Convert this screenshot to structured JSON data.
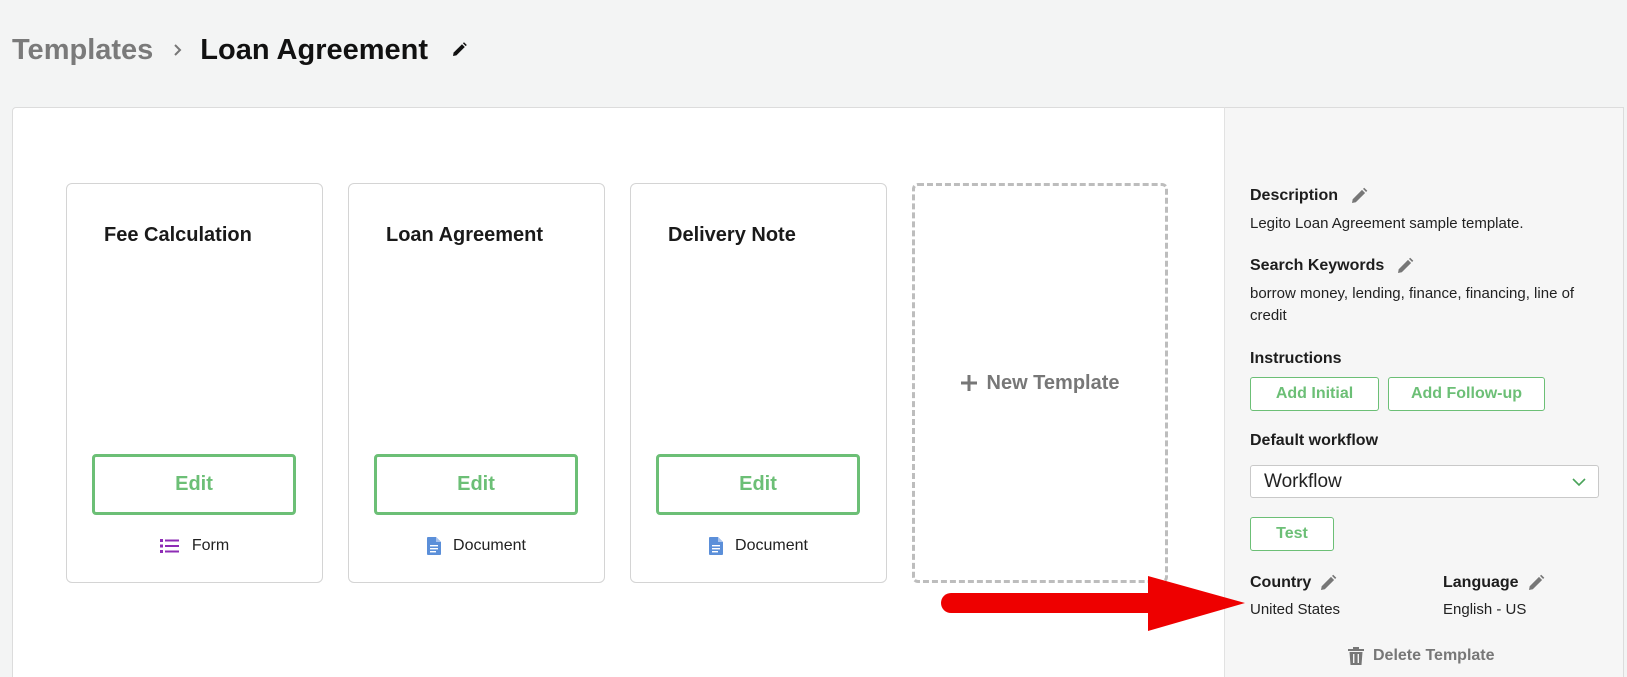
{
  "breadcrumb": {
    "root": "Templates",
    "current": "Loan Agreement"
  },
  "cards": [
    {
      "title": "Fee Calculation",
      "edit_label": "Edit",
      "type_label": "Form",
      "type_icon": "list-icon"
    },
    {
      "title": "Loan Agreement",
      "edit_label": "Edit",
      "type_label": "Document",
      "type_icon": "document-icon"
    },
    {
      "title": "Delivery Note",
      "edit_label": "Edit",
      "type_label": "Document",
      "type_icon": "document-icon"
    }
  ],
  "new_template": {
    "label": "New Template"
  },
  "side": {
    "description": {
      "label": "Description",
      "value": "Legito Loan Agreement sample template."
    },
    "keywords": {
      "label": "Search Keywords",
      "value": "borrow money, lending, finance, financing, line of credit"
    },
    "instructions": {
      "label": "Instructions",
      "add_initial": "Add Initial",
      "add_followup": "Add Follow-up"
    },
    "workflow": {
      "label": "Default workflow",
      "selected": "Workflow",
      "test_label": "Test"
    },
    "country": {
      "label": "Country",
      "value": "United States"
    },
    "language": {
      "label": "Language",
      "value": "English - US"
    },
    "delete_label": "Delete Template"
  },
  "colors": {
    "accent_green": "#6cbf76",
    "form_icon": "#8e2cb5",
    "document_icon": "#5b8fd9",
    "annotation_red": "#ee0000"
  }
}
